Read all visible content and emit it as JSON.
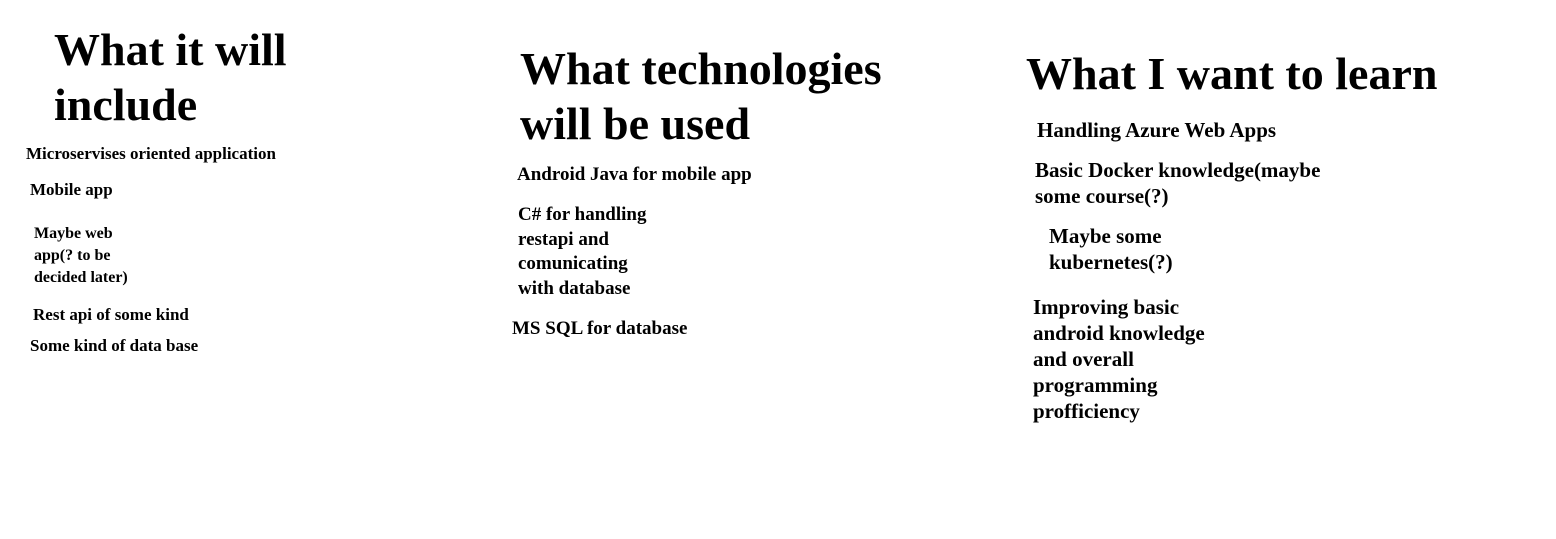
{
  "columns": [
    {
      "heading": "What it will\ninclude",
      "items": [
        "Microservises oriented application",
        "Mobile app",
        "Maybe web\napp(? to be\ndecided later)",
        "Rest api of some kind",
        "Some kind of data base"
      ]
    },
    {
      "heading": "What technologies\nwill be used",
      "items": [
        "Android Java for mobile app",
        "C# for handling\nrestapi and\ncomunicating\nwith database",
        "MS SQL for database"
      ]
    },
    {
      "heading": "What I want to learn",
      "items": [
        "Handling Azure Web Apps",
        "Basic Docker knowledge(maybe\nsome course(?)",
        "Maybe some\nkubernetes(?)",
        "Improving basic\nandroid knowledge\nand overall\nprogramming\nprofficiency"
      ]
    }
  ]
}
